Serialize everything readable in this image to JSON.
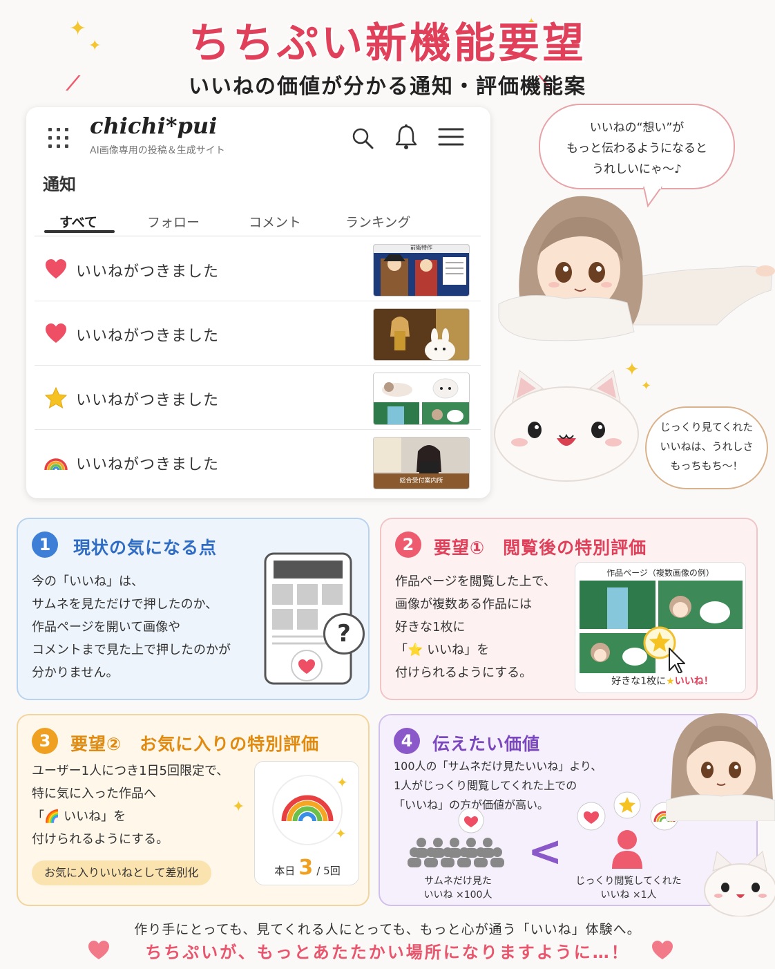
{
  "header": {
    "title": "ちちぷい新機能要望",
    "subtitle": "いいねの価値が分かる通知・評価機能案"
  },
  "app": {
    "logo": "chichi*pui",
    "tagline": "AI画像専用の投稿＆生成サイト",
    "page_title": "通知",
    "tabs": [
      "すべて",
      "フォロー",
      "コメント",
      "ランキング"
    ],
    "active_tab": "すべて",
    "notifications": [
      {
        "icon": "heart-icon",
        "text": "いいねがつきました",
        "thumb_caption": "前衛特作"
      },
      {
        "icon": "heart-icon",
        "text": "いいねがつきました",
        "thumb_caption": ""
      },
      {
        "icon": "star-icon",
        "text": "いいねがつきました",
        "thumb_caption": ""
      },
      {
        "icon": "rainbow-icon",
        "text": "いいねがつきました",
        "thumb_caption": "総合受付案内所"
      }
    ]
  },
  "bubbles": {
    "girl": [
      "いいねの“想い”が",
      "もっと伝わるようになると",
      "うれしいにゃ〜♪"
    ],
    "mochi": [
      "じっくり見てくれた",
      "いいねは、うれしさ",
      "もっちもち〜！"
    ]
  },
  "cards": {
    "c1": {
      "num": "1",
      "title": "現状の気になる点",
      "lines": [
        "今の「いいね」は、",
        "サムネを見ただけで押したのか、",
        "作品ページを開いて画像や",
        "コメントまで見た上で押したのかが",
        "分かりません。"
      ],
      "question": "?"
    },
    "c2": {
      "num": "2",
      "title": "要望①　閲覧後の特別評価",
      "lines": [
        "作品ページを閲覧した上で、",
        "画像が複数ある作品には",
        "好きな1枚に",
        "「⭐ いいね」を",
        "付けられるようにする。"
      ],
      "works_caption": "作品ページ（複数画像の例）",
      "works_note_pre": "好きな1枚に",
      "works_note_post": "いいね！"
    },
    "c3": {
      "num": "3",
      "title": "要望②　お気に入りの特別評価",
      "lines": [
        "ユーザー1人につき1日5回限定で、",
        "特に気に入った作品へ",
        "「🌈 いいね」を",
        "付けられるようにする。"
      ],
      "pill": "お気に入りいいねとして差別化",
      "counter_label": "本日",
      "counter_value": "3",
      "counter_total": "/ 5回"
    },
    "c4": {
      "num": "4",
      "title": "伝えたい価値",
      "lines": [
        "100人の「サムネだけ見たいいね」より、",
        "1人がじっくり閲覧してくれた上での",
        "「いいね」の方が価値が高い。"
      ],
      "left_caption": [
        "サムネだけ見た",
        "いいね ×100人"
      ],
      "right_caption": [
        "じっくり閲覧してくれた",
        "いいね ×1人"
      ],
      "comparator": "<"
    }
  },
  "footer": {
    "line1": "作り手にとっても、見てくれる人にとっても、もっと心が通う「いいね」体験へ。",
    "line2": "ちちぷいが、もっとあたたかい場所になりますように…！"
  },
  "colors": {
    "title": "#e0405a",
    "blue": "#3d7fd6",
    "pink": "#ee5a6e",
    "orange": "#f0a020",
    "purple": "#8a58c8"
  }
}
